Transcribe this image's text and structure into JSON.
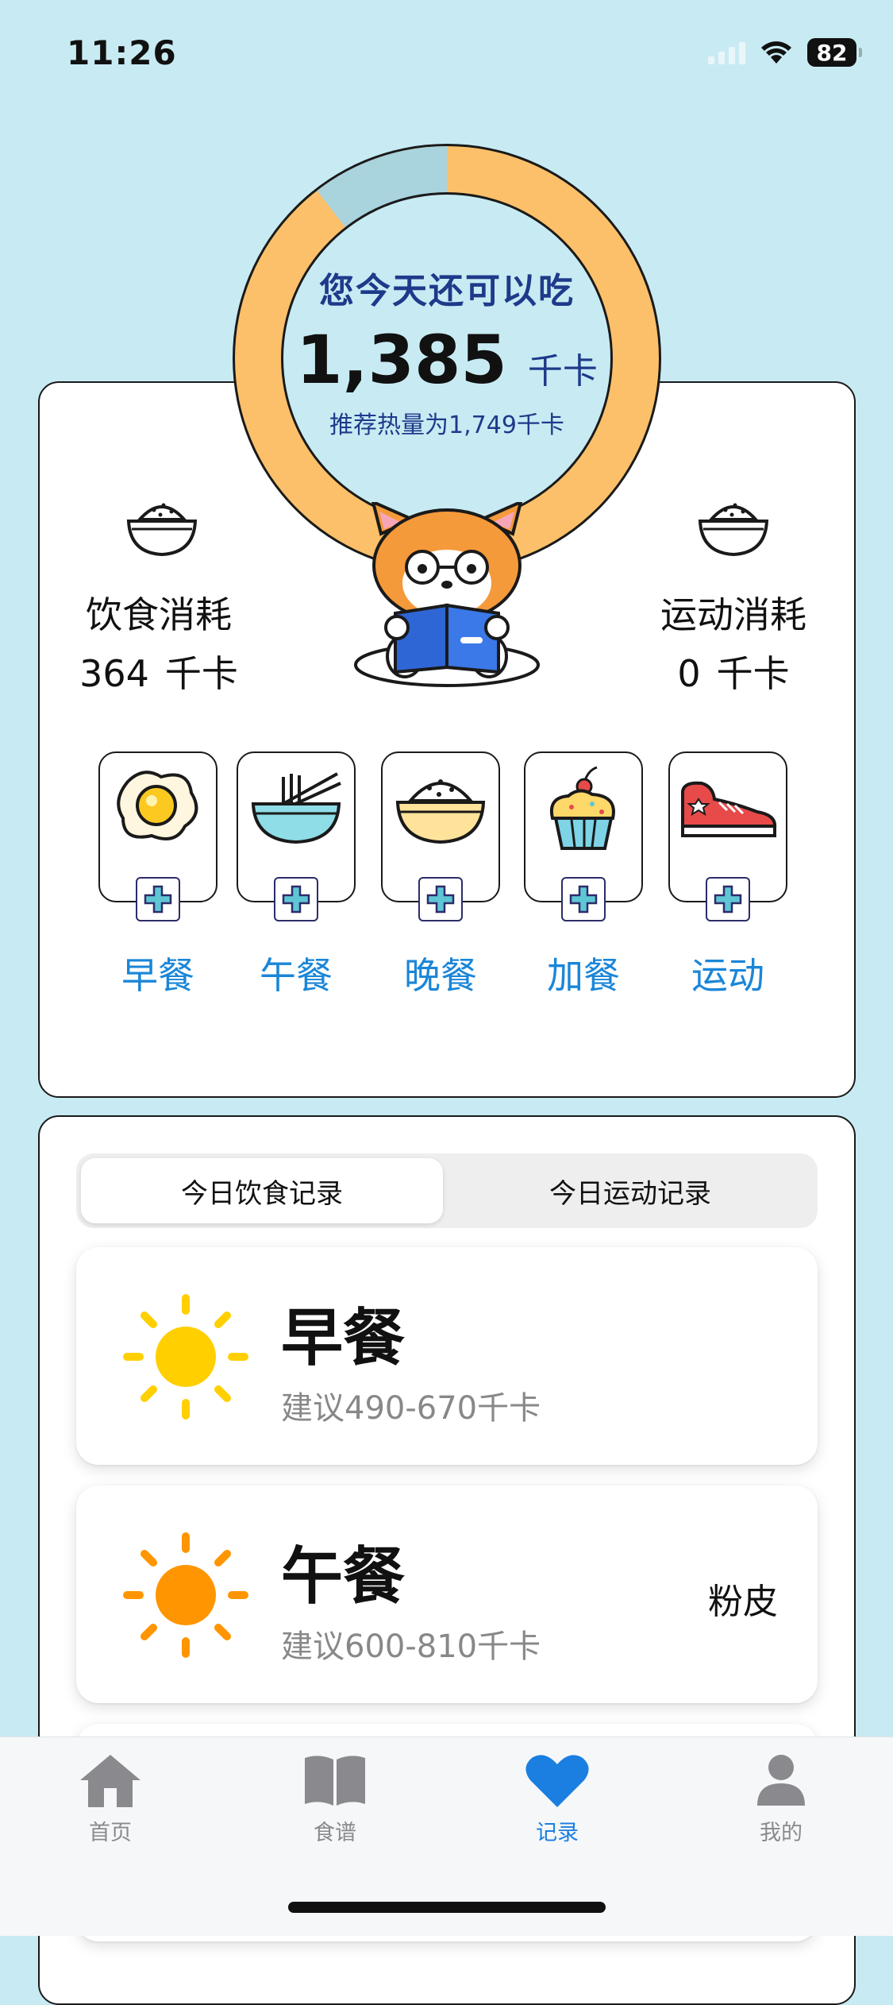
{
  "status_bar": {
    "time": "11:26",
    "battery": "82"
  },
  "calorie_ring": {
    "remaining_title": "您今天还可以吃",
    "remaining_value": "1,385",
    "remaining_unit": "千卡",
    "recommended_text": "推荐热量为1,749千卡",
    "consumed_fraction": 0.21
  },
  "diet": {
    "label": "饮食消耗",
    "value": "364",
    "unit": "千卡"
  },
  "exercise": {
    "label": "运动消耗",
    "value": "0",
    "unit": "千卡"
  },
  "meal_buttons": [
    {
      "label": "早餐",
      "icon": "fried-egg-icon"
    },
    {
      "label": "午餐",
      "icon": "noodle-bowl-icon"
    },
    {
      "label": "晚餐",
      "icon": "rice-bowl-icon"
    },
    {
      "label": "加餐",
      "icon": "cupcake-icon"
    },
    {
      "label": "运动",
      "icon": "sneaker-icon"
    }
  ],
  "records": {
    "tabs": [
      "今日饮食记录",
      "今日运动记录"
    ],
    "active_tab": 0,
    "meals": [
      {
        "title": "早餐",
        "suggestion": "建议490-670千卡",
        "food": "",
        "icon": "sun-yellow-icon"
      },
      {
        "title": "午餐",
        "suggestion": "建议600-810千卡",
        "food": "粉皮",
        "icon": "sun-orange-icon"
      }
    ]
  },
  "tab_bar": {
    "items": [
      {
        "label": "首页",
        "icon": "home-icon"
      },
      {
        "label": "食谱",
        "icon": "book-icon"
      },
      {
        "label": "记录",
        "icon": "heart-icon"
      },
      {
        "label": "我的",
        "icon": "person-icon"
      }
    ],
    "active_index": 2
  },
  "colors": {
    "background": "#c8ebf3",
    "ring_remaining": "#fcc06a",
    "ring_consumed": "#a9d3dd",
    "accent_blue": "#1a86d8",
    "tab_active": "#1a7fe0"
  }
}
